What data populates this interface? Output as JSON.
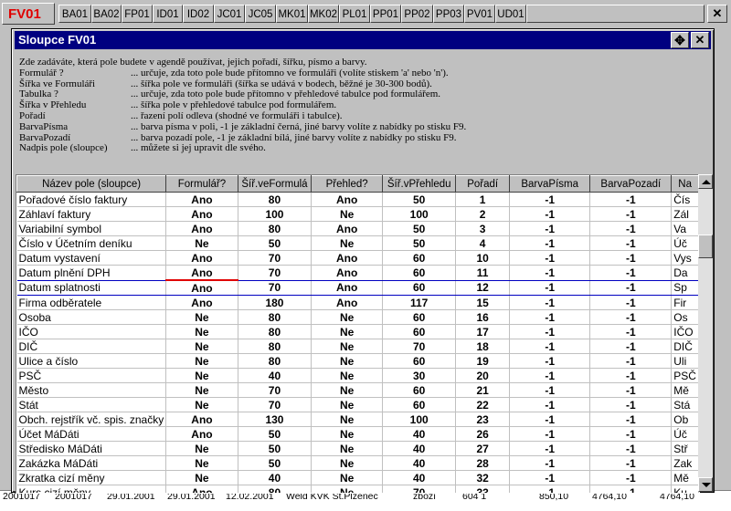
{
  "tabs": {
    "active": "FV01",
    "items": [
      "BA01",
      "BA02",
      "FP01",
      "ID01",
      "ID02",
      "JC01",
      "JC05",
      "MK01",
      "MK02",
      "PL01",
      "PP01",
      "PP02",
      "PP03",
      "PV01",
      "UD01"
    ]
  },
  "dialog": {
    "title": "Sloupce FV01",
    "intro": "Zde zadáváte, která pole budete v agendě používat, jejich pořadí, šířku, písmo a barvy.",
    "help": [
      {
        "key": "Formulář ?",
        "text": "... určuje, zda toto pole bude přítomno ve formuláři (volíte stiskem 'a' nebo 'n')."
      },
      {
        "key": "Šířka ve Formuláři",
        "text": "... šířka pole ve formuláři (šířka se udává v bodech, běžné je 30-300 bodů)."
      },
      {
        "key": "Tabulka ?",
        "text": "... určuje, zda toto pole bude přítomno v přehledové tabulce pod formulářem."
      },
      {
        "key": "Šířka v Přehledu",
        "text": "... šířka pole v přehledové tabulce pod formulářem."
      },
      {
        "key": "Pořadí",
        "text": "... řazení polí odleva (shodné ve formuláři i tabulce)."
      },
      {
        "key": "BarvaPísma",
        "text": "... barva písma v poli, -1 je základní černá, jiné barvy volíte z nabídky po stisku F9."
      },
      {
        "key": "BarvaPozadí",
        "text": "... barva pozadí pole, -1 je základní bílá, jiné barvy volíte z nabídky po stisku F9."
      },
      {
        "key": "Nadpis pole (sloupce)",
        "text": "... můžete si jej upravit dle svého."
      }
    ],
    "columns": [
      "Název pole (sloupce)",
      "Formulář?",
      "Šíř.veFormulá",
      "Přehled?",
      "Šíř.vPřehledu",
      "Pořadí",
      "BarvaPísma",
      "BarvaPozadí",
      "Na"
    ],
    "rows": [
      [
        "Pořadové číslo faktury",
        "Ano",
        "80",
        "Ano",
        "50",
        "1",
        "-1",
        "-1",
        "Čís"
      ],
      [
        "Záhlaví faktury",
        "Ano",
        "100",
        "Ne",
        "100",
        "2",
        "-1",
        "-1",
        "Zál"
      ],
      [
        "Variabilní symbol",
        "Ano",
        "80",
        "Ano",
        "50",
        "3",
        "-1",
        "-1",
        "Va"
      ],
      [
        "Číslo v Účetním deníku",
        "Ne",
        "50",
        "Ne",
        "50",
        "4",
        "-1",
        "-1",
        "Úč"
      ],
      [
        "Datum vystavení",
        "Ano",
        "70",
        "Ano",
        "60",
        "10",
        "-1",
        "-1",
        "Vys"
      ],
      [
        "Datum plnění DPH",
        "Ano",
        "70",
        "Ano",
        "60",
        "11",
        "-1",
        "-1",
        "Da"
      ],
      [
        "Datum splatnosti",
        "Ano",
        "70",
        "Ano",
        "60",
        "12",
        "-1",
        "-1",
        "Sp"
      ],
      [
        "Firma odběratele",
        "Ano",
        "180",
        "Ano",
        "117",
        "15",
        "-1",
        "-1",
        "Fir"
      ],
      [
        "Osoba",
        "Ne",
        "80",
        "Ne",
        "60",
        "16",
        "-1",
        "-1",
        "Os"
      ],
      [
        "IČO",
        "Ne",
        "80",
        "Ne",
        "60",
        "17",
        "-1",
        "-1",
        "IČO"
      ],
      [
        "DIČ",
        "Ne",
        "80",
        "Ne",
        "70",
        "18",
        "-1",
        "-1",
        "DIČ"
      ],
      [
        "Ulice a číslo",
        "Ne",
        "80",
        "Ne",
        "60",
        "19",
        "-1",
        "-1",
        "Uli"
      ],
      [
        "PSČ",
        "Ne",
        "40",
        "Ne",
        "30",
        "20",
        "-1",
        "-1",
        "PSČ"
      ],
      [
        "Město",
        "Ne",
        "70",
        "Ne",
        "60",
        "21",
        "-1",
        "-1",
        "Mě"
      ],
      [
        "Stát",
        "Ne",
        "70",
        "Ne",
        "60",
        "22",
        "-1",
        "-1",
        "Stá"
      ],
      [
        "Obch. rejstřík vč. spis. značky",
        "Ano",
        "130",
        "Ne",
        "100",
        "23",
        "-1",
        "-1",
        "Ob"
      ],
      [
        "Účet MáDáti",
        "Ano",
        "50",
        "Ne",
        "40",
        "26",
        "-1",
        "-1",
        "Úč"
      ],
      [
        "Středisko MáDáti",
        "Ne",
        "50",
        "Ne",
        "40",
        "27",
        "-1",
        "-1",
        "Stř"
      ],
      [
        "Zakázka MáDáti",
        "Ne",
        "50",
        "Ne",
        "40",
        "28",
        "-1",
        "-1",
        "Zak"
      ],
      [
        "Zkratka cizí měny",
        "Ne",
        "40",
        "Ne",
        "40",
        "32",
        "-1",
        "-1",
        "Mě"
      ],
      [
        "Kurs cizí měny",
        "Ano",
        "80",
        "Ne",
        "70",
        "33",
        "-1",
        "-1",
        "Ku"
      ]
    ],
    "current_row": 6
  },
  "background_row": [
    "2001017",
    "2001017",
    "29.01.2001",
    "29.01.2001",
    "12.02.2001",
    "Weld KVK St.Plzenec",
    "zboží",
    "604 1",
    "850,10",
    "4764,10",
    "4764,10"
  ]
}
